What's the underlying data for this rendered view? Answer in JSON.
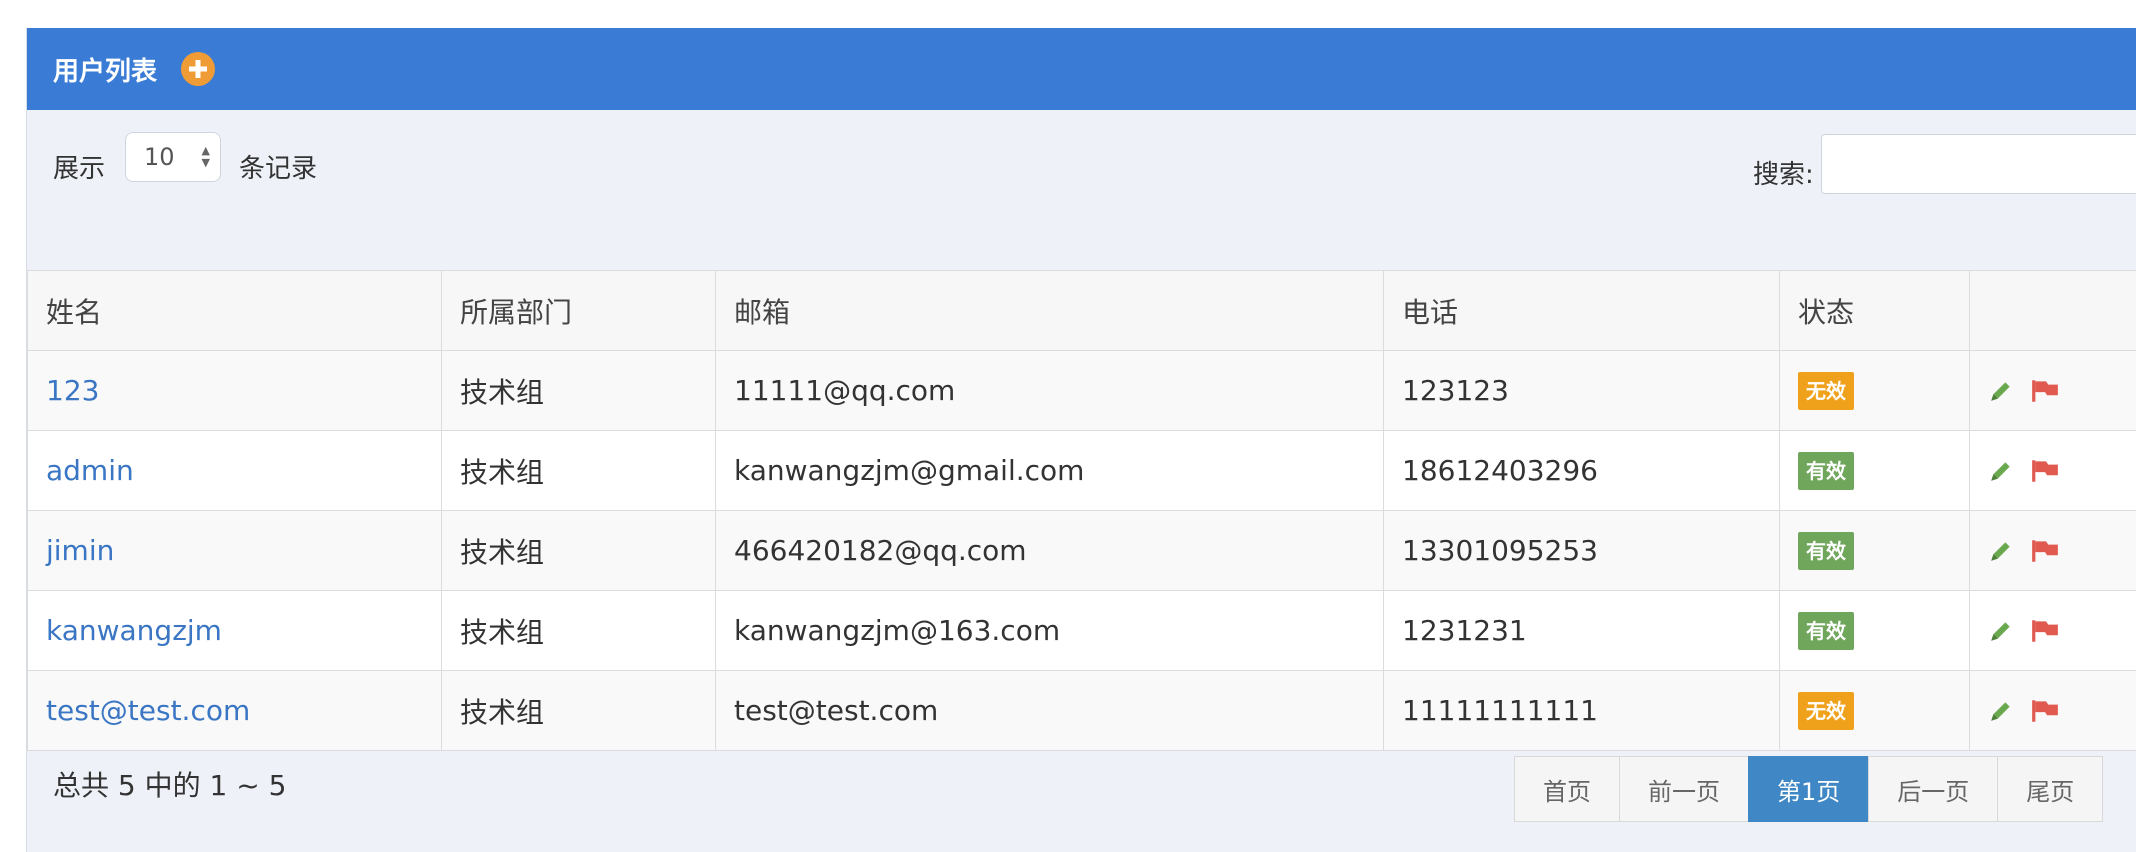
{
  "header": {
    "title": "用户列表",
    "add_icon": "plus-circle-icon",
    "add_color": "#f09c36",
    "bar_color": "#3a7bd5"
  },
  "controls": {
    "show_label": "展示",
    "page_size": "10",
    "records_label": "条记录",
    "search_label": "搜索:",
    "search_value": ""
  },
  "table": {
    "columns": [
      "姓名",
      "所属部门",
      "邮箱",
      "电话",
      "状态",
      ""
    ],
    "rows": [
      {
        "name": "123",
        "dept": "技术组",
        "email": "11111@qq.com",
        "phone": "123123",
        "status": "无效",
        "status_type": "inactive"
      },
      {
        "name": "admin",
        "dept": "技术组",
        "email": "kanwangzjm@gmail.com",
        "phone": "18612403296",
        "status": "有效",
        "status_type": "active"
      },
      {
        "name": "jimin",
        "dept": "技术组",
        "email": "466420182@qq.com",
        "phone": "13301095253",
        "status": "有效",
        "status_type": "active"
      },
      {
        "name": "kanwangzjm",
        "dept": "技术组",
        "email": "kanwangzjm@163.com",
        "phone": "1231231",
        "status": "有效",
        "status_type": "active"
      },
      {
        "name": "test@test.com",
        "dept": "技术组",
        "email": "test@test.com",
        "phone": "11111111111",
        "status": "无效",
        "status_type": "inactive"
      }
    ],
    "action_icons": [
      "pencil-icon",
      "flag-icon"
    ],
    "status_colors": {
      "active": "#6fa65b",
      "inactive": "#f0a11c"
    },
    "link_color": "#3a76c4"
  },
  "footer": {
    "summary": "总共 5 中的 1 ~ 5",
    "pagination": [
      "首页",
      "前一页",
      "第1页",
      "后一页",
      "尾页"
    ],
    "current_page_label": "第1页"
  }
}
